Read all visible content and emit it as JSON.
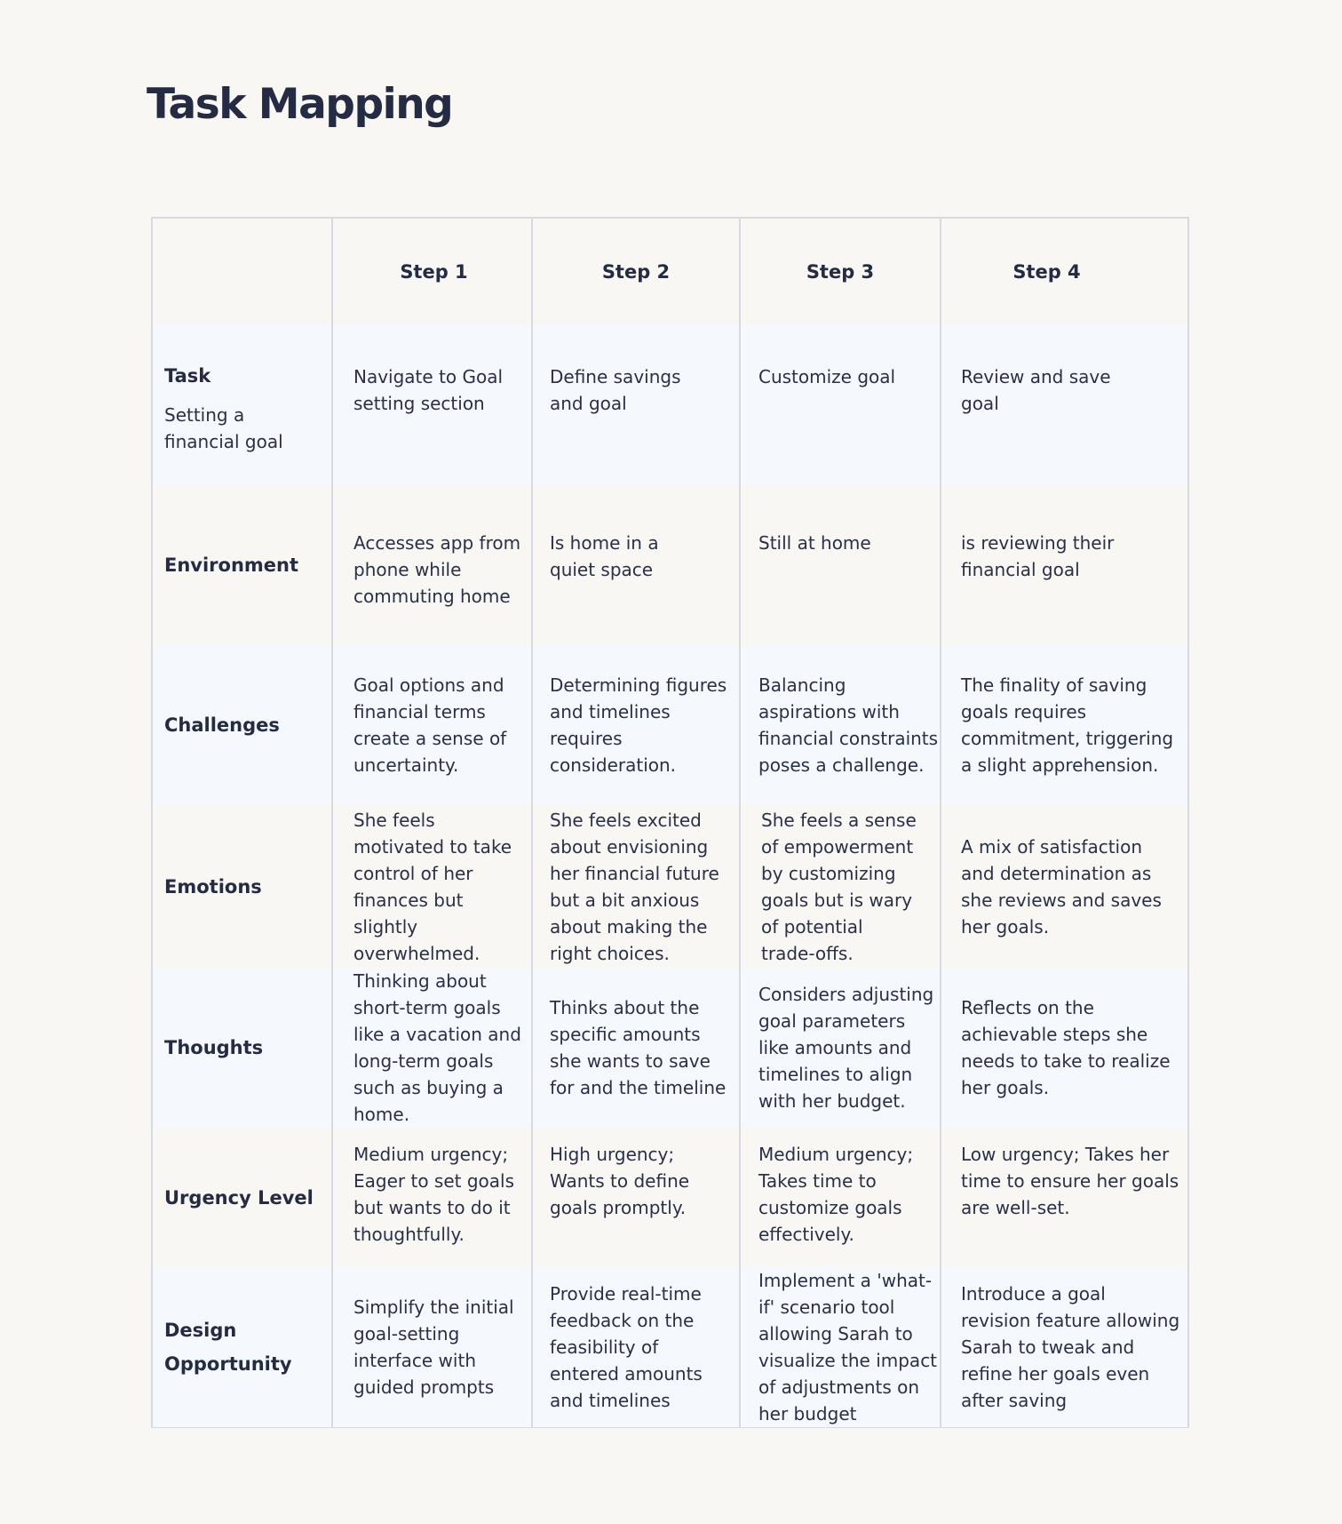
{
  "page": {
    "title": "Task Mapping"
  },
  "table": {
    "corner": "",
    "columns": [
      "Step 1",
      "Step 2",
      "Step 3",
      "Step 4"
    ],
    "rows": [
      {
        "label": "Task",
        "sublabel": "Setting a financial goal",
        "cells": [
          "Navigate to Goal setting section",
          "Define savings and goal",
          "Customize goal",
          "Review and save goal"
        ]
      },
      {
        "label": "Environment",
        "cells": [
          "Accesses app from phone while commuting home",
          "Is home in a quiet space",
          "Still at home",
          "is reviewing their financial goal"
        ]
      },
      {
        "label": "Challenges",
        "cells": [
          "Goal options and financial terms create a sense of uncertainty.",
          "Determining figures and timelines requires consideration.",
          "Balancing aspirations with financial constraints poses a challenge.",
          "The finality of saving goals requires commitment, triggering a slight apprehension."
        ]
      },
      {
        "label": "Emotions",
        "cells": [
          "She feels motivated to take control of her finances but slightly overwhelmed.",
          "She feels excited about envisioning her financial future but a bit anxious about making the right choices.",
          "She feels a sense of empowerment by customizing goals but is wary of potential trade-offs.",
          "A mix of satisfaction and determination as she reviews and saves her goals."
        ]
      },
      {
        "label": "Thoughts",
        "cells": [
          "Thinking about short-term goals like a vacation and long-term goals such as buying a home.",
          "Thinks about the specific amounts she wants to save for and the timeline",
          "Considers adjusting goal parameters like amounts and timelines to align with her budget.",
          "Reflects on the achievable steps she needs to take to realize her goals."
        ]
      },
      {
        "label": "Urgency Level",
        "cells": [
          "Medium urgency; Eager to set goals but wants to do it thoughtfully.",
          "High urgency; Wants to define goals promptly.",
          "Medium urgency; Takes time to customize goals effectively.",
          "Low urgency; Takes her time to ensure her goals are well-set."
        ]
      },
      {
        "label": "Design Opportunity",
        "cells": [
          "Simplify the initial goal-setting interface with guided prompts",
          "Provide real-time feedback on the feasibility of entered amounts and timelines",
          "Implement a 'what-if' scenario tool allowing Sarah to visualize the impact of adjustments on her budget",
          "Introduce a goal revision feature allowing Sarah to tweak and refine her goals even after saving"
        ]
      }
    ]
  },
  "colors": {
    "page_background": "#f8f7f4",
    "row_tint": "#f5f8fc",
    "border": "#d7dbe1",
    "text": "#252b42"
  }
}
